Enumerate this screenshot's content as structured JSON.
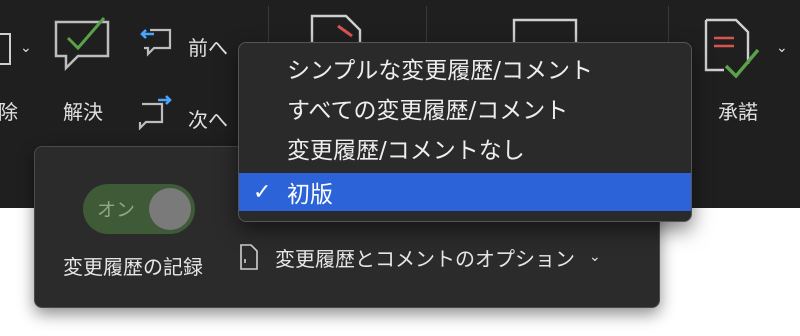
{
  "ribbon": {
    "partial_label_left": "除",
    "resolve_label": "解決",
    "previous_label": "前へ",
    "next_label": "次へ",
    "accept_label": "承諾"
  },
  "dropdown": {
    "items": [
      {
        "label": "シンプルな変更履歴/コメント",
        "selected": false
      },
      {
        "label": "すべての変更履歴/コメント",
        "selected": false
      },
      {
        "label": "変更履歴/コメントなし",
        "selected": false
      },
      {
        "label": "初版",
        "selected": true
      }
    ],
    "check_glyph": "✓"
  },
  "track_panel": {
    "toggle_text": "オン",
    "toggle_state": "on",
    "track_label": "変更履歴の記録",
    "options_label": "変更履歴とコメントのオプション"
  },
  "icons": [
    "chevron-down-icon",
    "resolve-comment-icon",
    "previous-comment-icon",
    "next-comment-icon",
    "document-icon",
    "accept-icon"
  ],
  "colors": {
    "ribbon_bg": "#1f1f1f",
    "panel_bg": "#2b2b2b",
    "selected_bg": "#2c63d8",
    "accent_green": "#5aa14a",
    "accent_red": "#d9534f",
    "accent_blue": "#4aa3ff"
  }
}
